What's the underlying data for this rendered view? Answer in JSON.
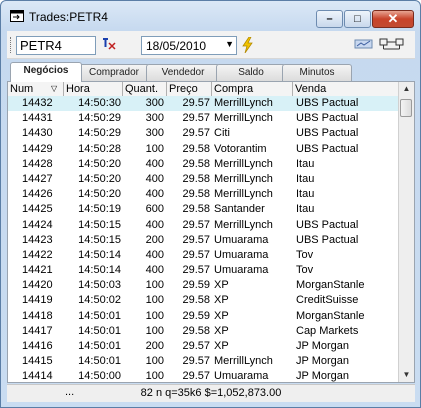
{
  "window": {
    "title": "Trades:PETR4"
  },
  "toolbar": {
    "ticker": "PETR4",
    "date": "18/05/2010"
  },
  "tabs": [
    "Negócios",
    "Comprador",
    "Vendedor",
    "Saldo",
    "Minutos"
  ],
  "columns": [
    "Num",
    "Hora",
    "Quant.",
    "Preço",
    "Compra",
    "Venda"
  ],
  "rows": [
    {
      "num": "14432",
      "hora": "14:50:30",
      "quant": "300",
      "preco": "29.57",
      "compra": "MerrillLynch",
      "venda": "UBS Pactual"
    },
    {
      "num": "14431",
      "hora": "14:50:29",
      "quant": "300",
      "preco": "29.57",
      "compra": "MerrillLynch",
      "venda": "UBS Pactual"
    },
    {
      "num": "14430",
      "hora": "14:50:29",
      "quant": "300",
      "preco": "29.57",
      "compra": "Citi",
      "venda": "UBS Pactual"
    },
    {
      "num": "14429",
      "hora": "14:50:28",
      "quant": "100",
      "preco": "29.58",
      "compra": "Votorantim",
      "venda": "UBS Pactual"
    },
    {
      "num": "14428",
      "hora": "14:50:20",
      "quant": "400",
      "preco": "29.58",
      "compra": "MerrillLynch",
      "venda": "Itau"
    },
    {
      "num": "14427",
      "hora": "14:50:20",
      "quant": "400",
      "preco": "29.58",
      "compra": "MerrillLynch",
      "venda": "Itau"
    },
    {
      "num": "14426",
      "hora": "14:50:20",
      "quant": "400",
      "preco": "29.58",
      "compra": "MerrillLynch",
      "venda": "Itau"
    },
    {
      "num": "14425",
      "hora": "14:50:19",
      "quant": "600",
      "preco": "29.58",
      "compra": "Santander",
      "venda": "Itau"
    },
    {
      "num": "14424",
      "hora": "14:50:15",
      "quant": "400",
      "preco": "29.57",
      "compra": "MerrillLynch",
      "venda": "UBS Pactual"
    },
    {
      "num": "14423",
      "hora": "14:50:15",
      "quant": "200",
      "preco": "29.57",
      "compra": "Umuarama",
      "venda": "UBS Pactual"
    },
    {
      "num": "14422",
      "hora": "14:50:14",
      "quant": "400",
      "preco": "29.57",
      "compra": "Umuarama",
      "venda": "Tov"
    },
    {
      "num": "14421",
      "hora": "14:50:14",
      "quant": "400",
      "preco": "29.57",
      "compra": "Umuarama",
      "venda": "Tov"
    },
    {
      "num": "14420",
      "hora": "14:50:03",
      "quant": "100",
      "preco": "29.59",
      "compra": "XP",
      "venda": "MorganStanle"
    },
    {
      "num": "14419",
      "hora": "14:50:02",
      "quant": "100",
      "preco": "29.58",
      "compra": "XP",
      "venda": "CreditSuisse"
    },
    {
      "num": "14418",
      "hora": "14:50:01",
      "quant": "100",
      "preco": "29.59",
      "compra": "XP",
      "venda": "MorganStanle"
    },
    {
      "num": "14417",
      "hora": "14:50:01",
      "quant": "100",
      "preco": "29.58",
      "compra": "XP",
      "venda": "Cap Markets"
    },
    {
      "num": "14416",
      "hora": "14:50:01",
      "quant": "200",
      "preco": "29.57",
      "compra": "XP",
      "venda": "JP Morgan"
    },
    {
      "num": "14415",
      "hora": "14:50:01",
      "quant": "100",
      "preco": "29.57",
      "compra": "MerrillLynch",
      "venda": "JP Morgan"
    },
    {
      "num": "14414",
      "hora": "14:50:00",
      "quant": "100",
      "preco": "29.57",
      "compra": "Umuarama",
      "venda": "JP Morgan"
    }
  ],
  "status": {
    "dots": "...",
    "summary": "82 n q=35k6 $=1,052,873.00"
  },
  "colors": {
    "selected_row": "#d8f1f7",
    "accent": "#3d78c4"
  }
}
